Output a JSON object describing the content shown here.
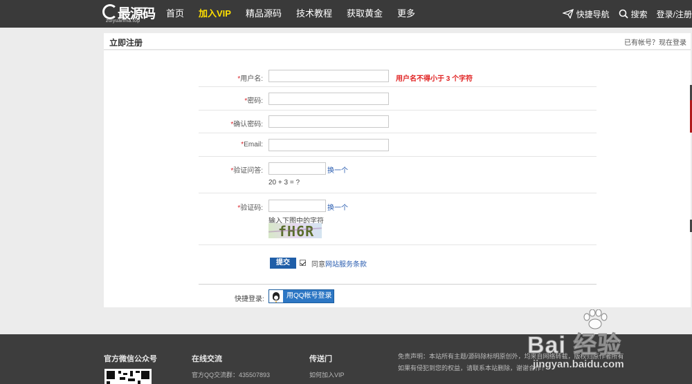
{
  "colors": {
    "topbar": "#3a3a3a",
    "vip": "#ffe000",
    "required": "#d8232a",
    "error": "#e02020",
    "link": "#2a5db0",
    "submit": "#1f5ea8",
    "footer": "#3d3d3d"
  },
  "header": {
    "logo_cn": "最源码",
    "logo_en": "zuiyuanma.top",
    "nav": [
      {
        "label": "首页"
      },
      {
        "label": "加入VIP",
        "highlight": true
      },
      {
        "label": "精品源码"
      },
      {
        "label": "技术教程"
      },
      {
        "label": "获取黄金"
      },
      {
        "label": "更多"
      }
    ],
    "right": {
      "quick_nav": "快捷导航",
      "quick_nav_icon": "paper-plane-icon",
      "search": "搜索",
      "search_icon": "search-icon",
      "login": "登录/注册"
    }
  },
  "panel": {
    "title": "立即注册",
    "has_account": "已有帐号？现在登录"
  },
  "form": {
    "required_mark": "*",
    "username": {
      "label": "用户名:",
      "value": "",
      "error": "用户名不得小于 3 个字符"
    },
    "password": {
      "label": "密码:",
      "value": ""
    },
    "confirm_password": {
      "label": "确认密码:",
      "value": ""
    },
    "email": {
      "label": "Email:",
      "value": ""
    },
    "question": {
      "label": "验证问答:",
      "value": "",
      "swap": "换一个",
      "prompt": "20 + 3 = ?"
    },
    "captcha": {
      "label": "验证码:",
      "value": "",
      "swap": "换一个",
      "prompt": "输入下图中的字符",
      "image_text": "fH6R"
    },
    "submit": "提交",
    "agree_prefix": "同意",
    "agree_terms": "网站服务条款",
    "agree_checked": true,
    "quick_login_label": "快捷登录:",
    "qq_login": "用QQ帐号登录"
  },
  "footer": {
    "wechat_title": "官方微信公众号",
    "chat_title": "在线交流",
    "chat_qq": "官方QQ交流群：435507893",
    "portal_title": "传送门",
    "portal_link": "如何加入VIP",
    "disclaimer_1": "免责声明：本站所有主题/源码除标明原创外，均来自网络转载，版权归原作者所有",
    "disclaimer_2": "如果有侵犯到您的权益，请联系本站删除，谢谢合作！"
  },
  "watermark": {
    "brand": "Bai 经验",
    "url": "jingyan.baidu.com"
  }
}
